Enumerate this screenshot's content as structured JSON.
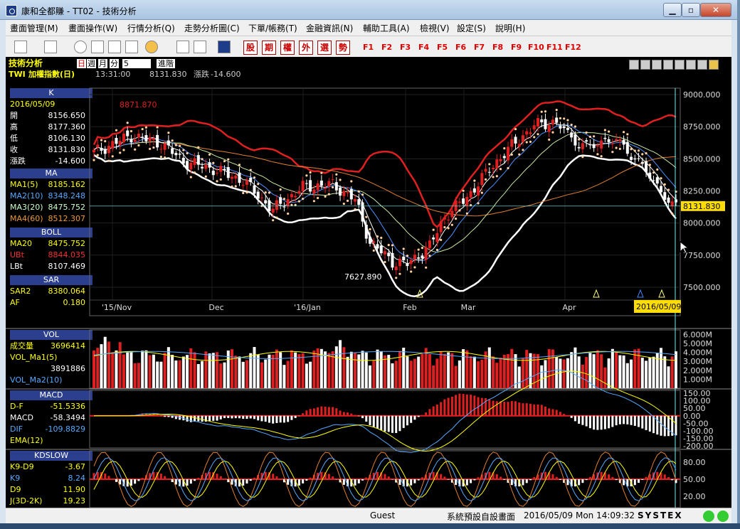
{
  "window": {
    "title": "康和全都賺 - TT02 - 技術分析"
  },
  "menu": [
    "畫面管理(M)",
    "畫面操作(W)",
    "行情分析(Q)",
    "走勢分析圖(C)",
    "下單/帳務(T)",
    "金融資訊(N)",
    "輔助工具(A)",
    "檢視(V)",
    "設定(S)",
    "說明(H)"
  ],
  "toolbar": {
    "text_tools": [
      "股",
      "期",
      "權",
      "外",
      "選",
      "勢"
    ],
    "fkeys": [
      "F1",
      "F2",
      "F3",
      "F4",
      "F5",
      "F6",
      "F7",
      "F8",
      "F9",
      "F10",
      "F11",
      "F12"
    ]
  },
  "header": {
    "section": "技術分析",
    "period_day": "日",
    "period_week": "週",
    "period_month": "月",
    "period_min": "分",
    "count": "5",
    "advanced": "進階",
    "symbol": "TWI",
    "name": "加權指數(日)",
    "time": "13:31:00",
    "price": "8131.830",
    "change_label": "漲跌",
    "change": "-14.600"
  },
  "panels": {
    "k": {
      "title": "K",
      "date": "2016/05/09",
      "rows": [
        [
          "開",
          "8156.650"
        ],
        [
          "高",
          "8177.360"
        ],
        [
          "低",
          "8106.130"
        ],
        [
          "收",
          "8131.830"
        ],
        [
          "漲跌",
          "-14.600"
        ]
      ]
    },
    "ma": {
      "title": "MA",
      "rows": [
        [
          "MA1(5)",
          "8185.162"
        ],
        [
          "MA2(10)",
          "8348.248"
        ],
        [
          "MA3(20)",
          "8475.752"
        ],
        [
          "MA4(60)",
          "8512.307"
        ]
      ]
    },
    "boll": {
      "title": "BOLL",
      "rows": [
        [
          "MA20",
          "8475.752"
        ],
        [
          "UBt",
          "8844.035"
        ],
        [
          "LBt",
          "8107.469"
        ]
      ]
    },
    "sar": {
      "title": "SAR",
      "rows": [
        [
          "SAR2",
          "8380.064"
        ],
        [
          "AF",
          "0.180"
        ]
      ]
    },
    "vol": {
      "title": "VOL",
      "rows": [
        [
          "成交量",
          "3696414"
        ],
        [
          "VOL_Ma1(5)",
          ""
        ],
        [
          "",
          "3891886"
        ],
        [
          "VOL_Ma2(10)",
          ""
        ]
      ]
    },
    "macd": {
      "title": "MACD",
      "rows": [
        [
          "D-F",
          "-51.5336"
        ],
        [
          "MACD",
          "-58.3494"
        ],
        [
          "DIF",
          "-109.8829"
        ],
        [
          "EMA(12)",
          ""
        ]
      ]
    },
    "kd": {
      "title": "KDSLOW",
      "rows": [
        [
          "K9-D9",
          "-3.67"
        ],
        [
          "K9",
          "8.24"
        ],
        [
          "D9",
          "11.90"
        ],
        [
          "J(3D-2K)",
          "19.23"
        ]
      ]
    }
  },
  "main_chart": {
    "yticks": [
      "9000.000",
      "8750.000",
      "8500.000",
      "8250.000",
      "8000.000",
      "7750.000",
      "7500.000"
    ],
    "xticks": [
      "'15/Nov",
      "Dec",
      "'16/Jan",
      "Feb",
      "Mar",
      "Apr"
    ],
    "date_marker": "2016/05/09",
    "price_marker": "8131.830",
    "high_annotation": "8871.870",
    "low_annotation": "7627.890"
  },
  "vol_axis": [
    "6.000M",
    "5.000M",
    "4.000M",
    "3.000M",
    "2.000M",
    "1.000M"
  ],
  "macd_axis": [
    "150.00",
    "100.00",
    "50.00",
    "0.00",
    "-50.00",
    "-100.00",
    "-150.00",
    "-200.00"
  ],
  "kd_axis": [
    "80.00",
    "50.00",
    "20.00"
  ],
  "status": {
    "user": "Guest",
    "layout": "系統預設自設畫面",
    "datetime": "2016/05/09 Mon 14:09:32",
    "brand": "SYSTEX"
  }
}
